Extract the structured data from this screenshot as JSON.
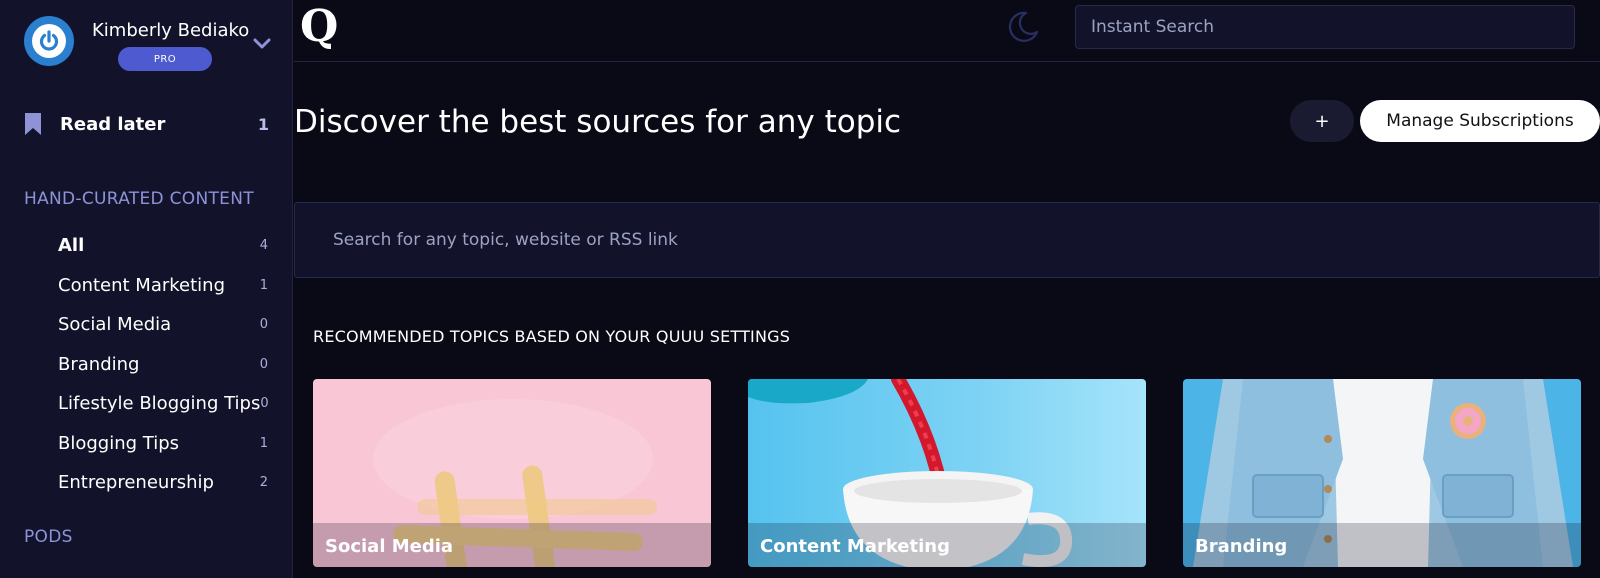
{
  "user": {
    "name": "Kimberly Bediako",
    "badge": "PRO"
  },
  "sidebar": {
    "read_later": {
      "label": "Read later",
      "count": "1"
    },
    "hand_curated_heading": "HAND-CURATED CONTENT",
    "items": [
      {
        "label": "All",
        "count": "4"
      },
      {
        "label": "Content Marketing",
        "count": "1"
      },
      {
        "label": "Social Media",
        "count": "0"
      },
      {
        "label": "Branding",
        "count": "0"
      },
      {
        "label": "Lifestyle Blogging Tips",
        "count": "0"
      },
      {
        "label": "Blogging Tips",
        "count": "1"
      },
      {
        "label": "Entrepreneurship",
        "count": "2"
      }
    ],
    "pods_heading": "PODS"
  },
  "header": {
    "logo": "Q",
    "search_placeholder": "Instant Search",
    "theme_icon": "moon-icon"
  },
  "main": {
    "title": "Discover the best sources for any topic",
    "plus_label": "+",
    "manage_label": "Manage Subscriptions",
    "topic_search_placeholder": "Search for any topic, website or RSS link",
    "recommended_heading": "RECOMMENDED TOPICS BASED ON YOUR QUUU SETTINGS",
    "cards": [
      {
        "label": "Social Media"
      },
      {
        "label": "Content Marketing"
      },
      {
        "label": "Branding"
      }
    ]
  },
  "colors": {
    "background": "#0a0a16",
    "sidebar": "#12132a",
    "accent": "#4e5bd0",
    "section_heading": "#8e93d8"
  }
}
